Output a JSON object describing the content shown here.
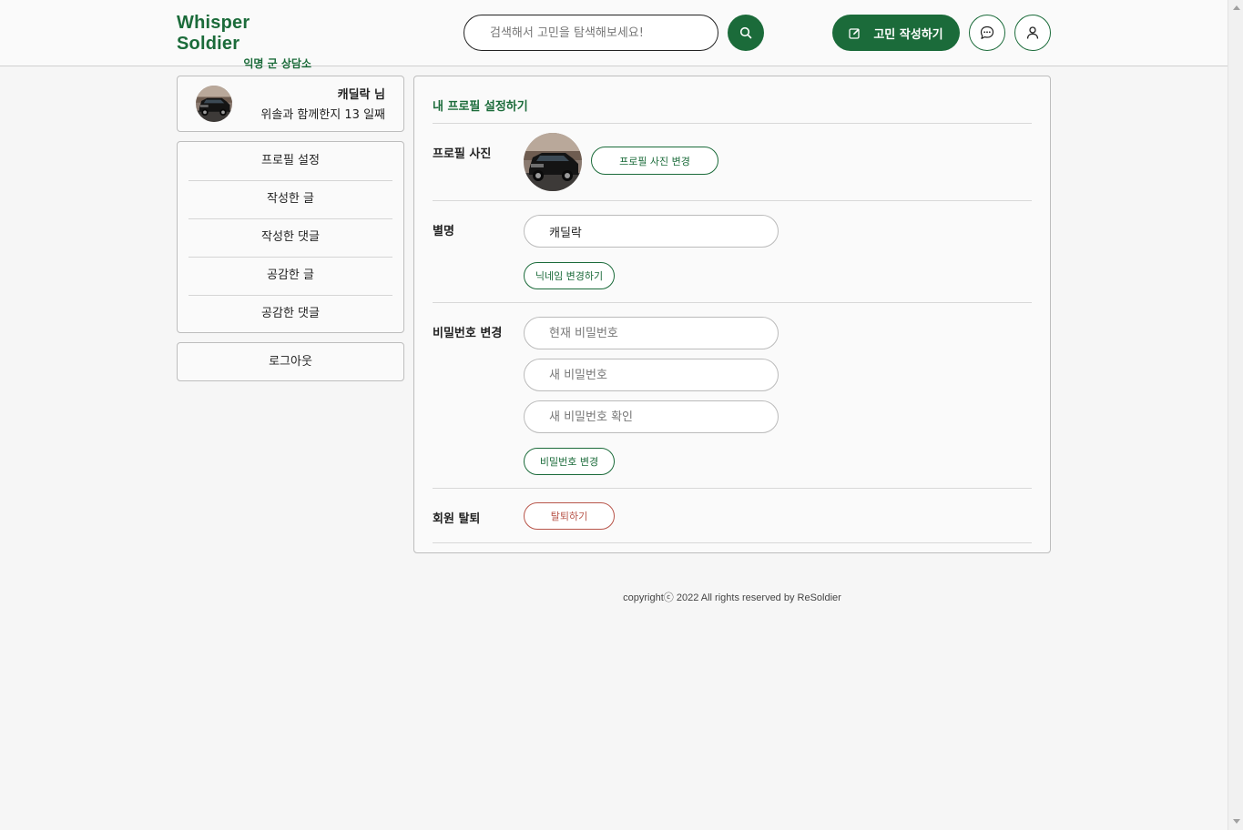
{
  "header": {
    "logo_title": "Whisper Soldier",
    "logo_subtitle": "익명 군 상담소",
    "search_placeholder": "검색해서 고민을 탐색해보세요!",
    "write_label": "고민 작성하기",
    "brand_color": "#1b6b3a",
    "icons": [
      "search-icon",
      "pencil-square-icon",
      "chat-bubble-icon",
      "user-icon"
    ]
  },
  "sidebar": {
    "user_name": "캐딜락 님",
    "user_days": "위솔과 함께한지 13 일째",
    "items": [
      {
        "label": "프로필 설정"
      },
      {
        "label": "작성한 글"
      },
      {
        "label": "작성한 댓글"
      },
      {
        "label": "공감한 글"
      },
      {
        "label": "공감한 댓글"
      }
    ],
    "logout_label": "로그아웃"
  },
  "profile": {
    "title": "내 프로필 설정하기",
    "photo_label": "프로필 사진",
    "photo_change_label": "프로필 사진 변경",
    "nickname_label": "별명",
    "nickname_value": "캐딜락",
    "nickname_change_label": "닉네임 변경하기",
    "password_label": "비밀번호 변경",
    "current_password_placeholder": "현재 비밀번호",
    "new_password_placeholder": "새 비밀번호",
    "confirm_password_placeholder": "새 비밀번호 확인",
    "password_change_label": "비밀번호 변경",
    "withdraw_label": "회원 탈퇴",
    "withdraw_button_label": "탈퇴하기",
    "danger_color": "#b8554a"
  },
  "footer": {
    "text": "copyrightⓒ 2022 All rights reserved by ReSoldier"
  }
}
